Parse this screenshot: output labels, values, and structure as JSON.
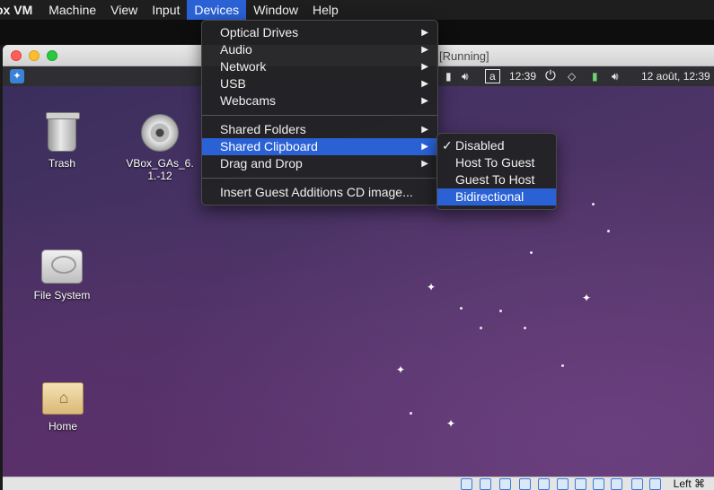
{
  "menubar": {
    "app_name": "ox VM",
    "items": [
      "Machine",
      "View",
      "Input",
      "Devices",
      "Window",
      "Help"
    ],
    "active": "Devices"
  },
  "window": {
    "title": "[Running]"
  },
  "guest_panel": {
    "time_left": "12:39",
    "keyboard_indicator": "a",
    "date_time": "12 août, 12:39"
  },
  "desktop_icons": [
    {
      "label": "Trash",
      "icon": "trash-icon"
    },
    {
      "label": "VBox_GAs_6.1.-12",
      "icon": "disc-icon"
    },
    {
      "label": "File System",
      "icon": "hard-drive-icon"
    },
    {
      "label": "Home",
      "icon": "home-folder-icon"
    }
  ],
  "devices_menu": {
    "group1": [
      "Optical Drives",
      "Audio",
      "Network",
      "USB",
      "Webcams"
    ],
    "group2": [
      "Shared Folders",
      "Shared Clipboard",
      "Drag and Drop"
    ],
    "highlighted": "Shared Clipboard",
    "action": "Insert Guest Additions CD image..."
  },
  "clipboard_submenu": {
    "items": [
      "Disabled",
      "Host To Guest",
      "Guest To Host",
      "Bidirectional"
    ],
    "checked": "Disabled",
    "highlighted": "Bidirectional",
    "check_glyph": "✓"
  },
  "status_bar": {
    "host_key": "Left ⌘"
  },
  "colors": {
    "highlight": "#2a62d6",
    "menu_bg": "#222224"
  }
}
